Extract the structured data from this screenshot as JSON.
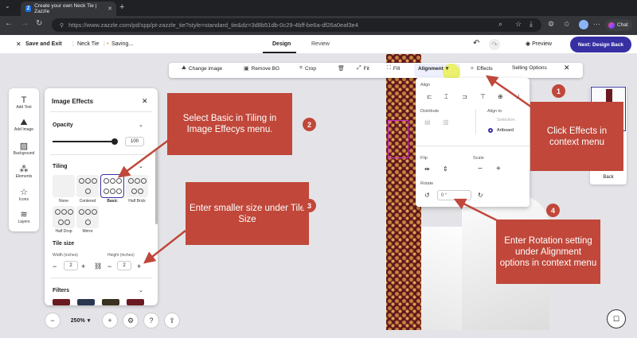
{
  "browser": {
    "tab_title": "Create your own Neck Tie | Zazzle",
    "tab_icon": "Z",
    "url": "https://www.zazzle.com/pd/spp/pt-zazzle_tie?style=standard_tie&dz=3d8b51db-0c29-4bff-be6a-df26a0eaf3e4",
    "chat_label": "Chat"
  },
  "header": {
    "save_exit": "Save and Exit",
    "product": "Neck Tie",
    "status": "Saving...",
    "tabs": [
      "Design",
      "Review"
    ],
    "preview": "Preview",
    "next": "Next: Design Back"
  },
  "context_menu": {
    "items": [
      "Change image",
      "Remove BG",
      "Crop",
      "Fit",
      "Fill",
      "Alignment",
      "Effects",
      "Selling Options"
    ]
  },
  "rail": {
    "items": [
      "Add Text",
      "Add Image",
      "Background",
      "Elements",
      "Icons",
      "Layers"
    ]
  },
  "panel": {
    "title": "Image Effects",
    "opacity_label": "Opacity",
    "opacity_value": "100",
    "tiling_label": "Tiling",
    "tiles": [
      "None",
      "Centered",
      "Basic",
      "Half Brick",
      "Half Drop",
      "Mirror"
    ],
    "tile_size_label": "Tile size",
    "width_label": "Width (inches)",
    "height_label": "Height (inches)",
    "width_value": "2",
    "height_value": "2",
    "filters_label": "Filters"
  },
  "alignment": {
    "align_label": "Align",
    "distribute_label": "Distribute",
    "align_to_label": "Align to",
    "selection_label": "Selection",
    "artboard_label": "Artboard",
    "flip_label": "Flip",
    "scale_label": "Scale",
    "rotate_label": "Rotate",
    "rotate_value": "0 °"
  },
  "thumbs": {
    "back_label": "Back"
  },
  "zoom": {
    "value": "250%"
  },
  "annotations": {
    "c1": "Click Effects in context menu",
    "c2": "Select Basic in Tiling  in Image Effecys menu.",
    "c3": "Enter smaller size under Tile Size",
    "c4": "Enter Rotation setting under Alignment options in context menu",
    "n1": "1",
    "n2": "2",
    "n3": "3",
    "n4": "4"
  },
  "colors": {
    "accent": "#3730a3",
    "callout": "#c0473a",
    "tie": "#6a1a20"
  }
}
